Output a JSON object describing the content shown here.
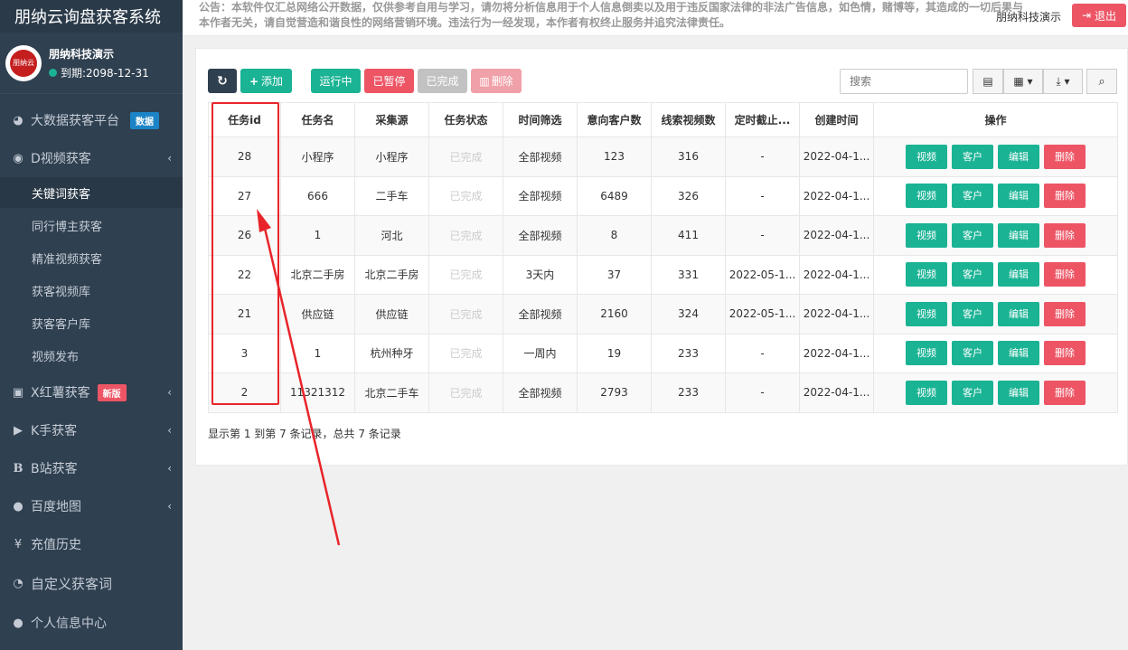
{
  "app": {
    "title": "朋纳云询盘获客系统"
  },
  "profile": {
    "avatar_text": "朋纳云",
    "name": "朋纳科技演示",
    "expire": "到期:2098-12-31"
  },
  "sidebar": {
    "items": [
      {
        "label": "大数据获客平台",
        "icon": "dashboard-icon",
        "badge": "数据"
      },
      {
        "label": "D视频获客",
        "icon": "eye-icon"
      },
      {
        "label": "X红薯获客",
        "icon": "image-icon",
        "badge": "新版"
      },
      {
        "label": "K手获客",
        "icon": "play-circle-icon"
      },
      {
        "label": "B站获客",
        "icon": "b-icon"
      },
      {
        "label": "百度地图",
        "icon": "map-marker-icon"
      },
      {
        "label": "充值历史",
        "icon": "yen-icon"
      },
      {
        "label": "自定义获客词",
        "icon": "rss-icon"
      },
      {
        "label": "个人信息中心",
        "icon": "user-icon"
      }
    ],
    "submenu": [
      "关键词获客",
      "同行博主获客",
      "精准视频获客",
      "获客视频库",
      "获客客户库",
      "视频发布"
    ]
  },
  "header": {
    "notice": "公告：本软件仅汇总网络公开数据，仅供参考自用与学习，请勿将分析信息用于个人信息倒卖以及用于违反国家法律的非法广告信息，如色情，赌博等，其造成的一切后果与本作者无关，请自觉营造和谐良性的网络营销环境。违法行为一经发现，本作者有权终止服务并追究法律责任。",
    "user": "朋纳科技演示",
    "logout": "退出"
  },
  "toolbar": {
    "add": "添加",
    "running": "运行中",
    "paused": "已暂停",
    "done": "已完成",
    "delete": "删除",
    "search_placeholder": "搜索"
  },
  "table": {
    "headers": [
      "任务id",
      "任务名",
      "采集源",
      "任务状态",
      "时间筛选",
      "意向客户数",
      "线索视频数",
      "定时截止...",
      "创建时间",
      "操作"
    ],
    "rows": [
      [
        "28",
        "小程序",
        "小程序",
        "已完成",
        "全部视频",
        "123",
        "316",
        "-",
        "2022-04-1..."
      ],
      [
        "27",
        "666",
        "二手车",
        "已完成",
        "全部视频",
        "6489",
        "326",
        "-",
        "2022-04-1..."
      ],
      [
        "26",
        "1",
        "河北",
        "已完成",
        "全部视频",
        "8",
        "411",
        "-",
        "2022-04-1..."
      ],
      [
        "22",
        "北京二手房",
        "北京二手房",
        "已完成",
        "3天内",
        "37",
        "331",
        "2022-05-1...",
        "2022-04-1..."
      ],
      [
        "21",
        "供应链",
        "供应链",
        "已完成",
        "全部视频",
        "2160",
        "324",
        "2022-05-1...",
        "2022-04-1..."
      ],
      [
        "3",
        "1",
        "杭州种牙",
        "已完成",
        "一周内",
        "19",
        "233",
        "-",
        "2022-04-1..."
      ],
      [
        "2",
        "11321312",
        "北京二手车",
        "已完成",
        "全部视频",
        "2793",
        "233",
        "-",
        "2022-04-1..."
      ]
    ],
    "ops": [
      "视频",
      "客户",
      "编辑",
      "删除"
    ]
  },
  "footer": "显示第 1 到第 7 条记录，总共 7 条记录",
  "colors": {
    "sidebar": "#2f4050",
    "green": "#1ab394",
    "red": "#ed5565",
    "annotation": "#e8242a"
  }
}
